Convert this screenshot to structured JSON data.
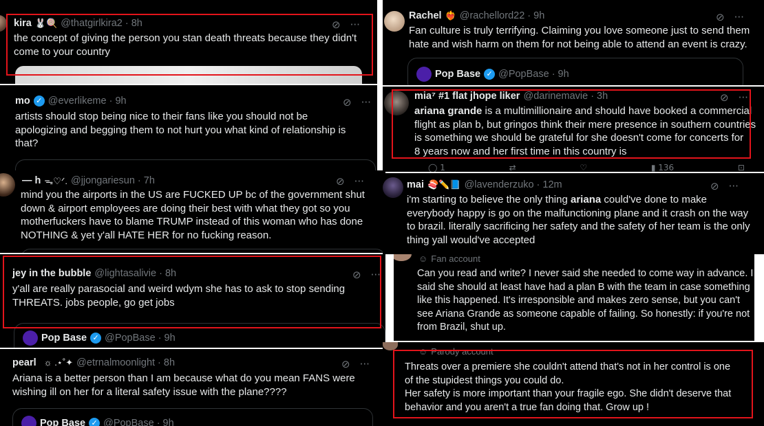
{
  "tweets": {
    "kira": {
      "name": "kira",
      "deco": "🐰🍭",
      "handle": "@thatgirlkira2 · 8h",
      "text": "the concept of giving the person you stan death threats because they didn't\ncome to your country"
    },
    "mo": {
      "name": "mo",
      "handle": "@everlikeme · 9h",
      "text": "artists should stop being nice to their fans like you should not be\napologizing and begging them to not hurt you what kind of relationship is\nthat?"
    },
    "h": {
      "name": "— h",
      "deco": "ᯓ♡ᐟ.",
      "handle": "@jjongariesun · 7h",
      "text": "mind you the airports in the US are FUCKED UP bc of the government shut\ndown & airport employees are doing their best with what they got so you\nmotherfuckers have to blame TRUMP instead of this woman who has done\nNOTHING & yet y'all HATE HER for no fucking reason."
    },
    "jey": {
      "name": "jey in the bubble",
      "handle": "@lightasalivie · 8h",
      "text": "y'all are really parasocial and weird wdym she has to ask to stop sending\nTHREATS. jobs people, go get jobs",
      "quote_name": "Pop Base",
      "quote_handle": "@PopBase · 9h"
    },
    "pearl": {
      "name": "pearl",
      "deco": "☼  .⋆˚✦",
      "handle": "@etrnalmoonlight · 8h",
      "text": "Ariana is a better person than I am because what do you mean FANS were\nwishing ill on her for a literal safety issue with the plane????",
      "quote_name": "Pop Base",
      "quote_handle": "@PopBase · 9h"
    },
    "rachel": {
      "name": "Rachel",
      "deco": "❤‍🔥",
      "handle": "@rachellord22 · 9h",
      "text": "Fan culture is truly terrifying. Claiming you love someone just to send them\nhate and wish harm on them for not being able to attend an event is crazy.",
      "quote_name": "Pop Base",
      "quote_handle": "@PopBase · 9h"
    },
    "mia": {
      "name": "mia⁷ #1 flat jhope liker",
      "handle": "@darinemavie · 3h",
      "bold_lead": "ariana grande",
      "text_rest": " is a multimillionaire and should have booked a commercial\nflight as plan b, but gringos think their mere presence in southern countries\nis something we should be grateful for     she doesn't come for concerts for\n8 years now and her first time in this country is",
      "action_reply": "1",
      "action_views": "136"
    },
    "mai": {
      "name": "mai",
      "deco": "🍣✏️📘",
      "handle": "@lavenderzuko · 12m",
      "text_a": "i'm starting to believe the only thing ",
      "bold_mid": "ariana",
      "text_b": " could've done to make\neverybody happy is go on the malfunctioning plane and it crash on the way\nto brazil. literally sacrificing her safety and the safety of her team is the only\nthing yall would've accepted"
    },
    "fan": {
      "label": "Fan account",
      "text": "Can you read and write? I never said she needed to come way in advance. I\nsaid she should at least have had a plan B with the team in case something\nlike this happened. It's irresponsible and makes zero sense, but you can't\nsee Ariana Grande as someone capable of failing. So honestly: if you're not\nfrom Brazil, shut up."
    },
    "parody": {
      "label": "Parody account",
      "text": "Threats over a premiere she couldn't attend that's not in her control is one\nof the stupidest things you could do.\nHer safety is more important than your fragile ego. She didn't deserve that\nbehavior and you aren't a true fan doing that. Grow up !"
    }
  },
  "icons": {
    "grok": "⊘",
    "more": "···",
    "verified": "✓",
    "reply": "◯",
    "repost": "⇄",
    "like": "♡",
    "views": "▮",
    "bookmark": "⊡"
  },
  "colors": {
    "background": "#000000",
    "text": "#e7e9ea",
    "muted": "#71767b",
    "verified": "#1d9bf0",
    "highlight_box": "#e3141b"
  }
}
